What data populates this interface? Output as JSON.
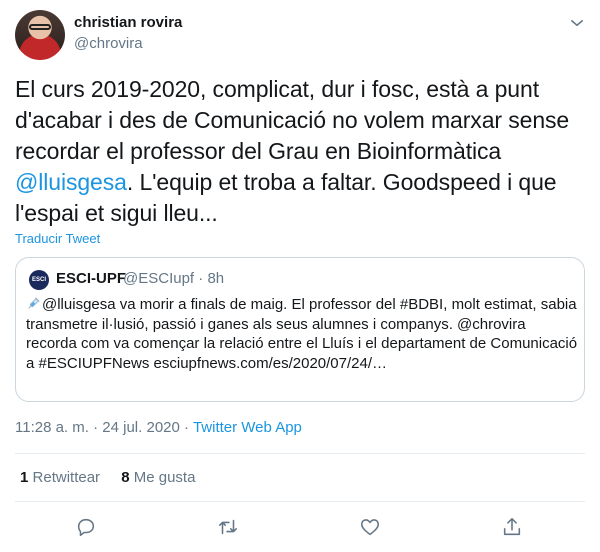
{
  "author": {
    "name": "christian rovira",
    "handle": "@chrovira"
  },
  "tweet": {
    "text_before": "El curs 2019-2020, complicat, dur i fosc, està a punt d'acabar i des de Comunicació no volem marxar sense recordar el professor del Grau en Bioinformàtica ",
    "mention": "@lluisgesa",
    "text_after": ". L'equip et troba a faltar. Goodspeed i que l'espai et sigui lleu...",
    "translate_label": "Traducir Tweet"
  },
  "quoted_tweet": {
    "avatar_text": "ESCI",
    "name": "ESCI-UPF",
    "handle": "@ESCIupf",
    "separator": "·",
    "age": "8h",
    "body": "@lluisgesa va morir a finals de maig. El professor del #BDBI, molt estimat, sabia transmetre il·lusió, passió i ganes als seus alumnes i companys. @chrovira recorda com va començar la relació entre el Lluís i el departament de Comunicació a #ESCIUPFNews esciupfnews.com/es/2020/07/24/…"
  },
  "meta": {
    "time": "11:28 a. m.",
    "separator1": "·",
    "date": "24 jul. 2020",
    "separator2": "·",
    "source": "Twitter Web App"
  },
  "stats": {
    "retweets_count": "1",
    "retweets_label": "Retwittear",
    "likes_count": "8",
    "likes_label": "Me gusta"
  },
  "actions": {
    "icons": [
      "reply-icon",
      "retweet-icon",
      "like-icon",
      "share-icon"
    ]
  },
  "colors": {
    "link": "#1b95e0",
    "secondary_text": "#657786",
    "primary_text": "#14171a",
    "border": "#ccd6dd",
    "divider": "#e6ecf0"
  }
}
